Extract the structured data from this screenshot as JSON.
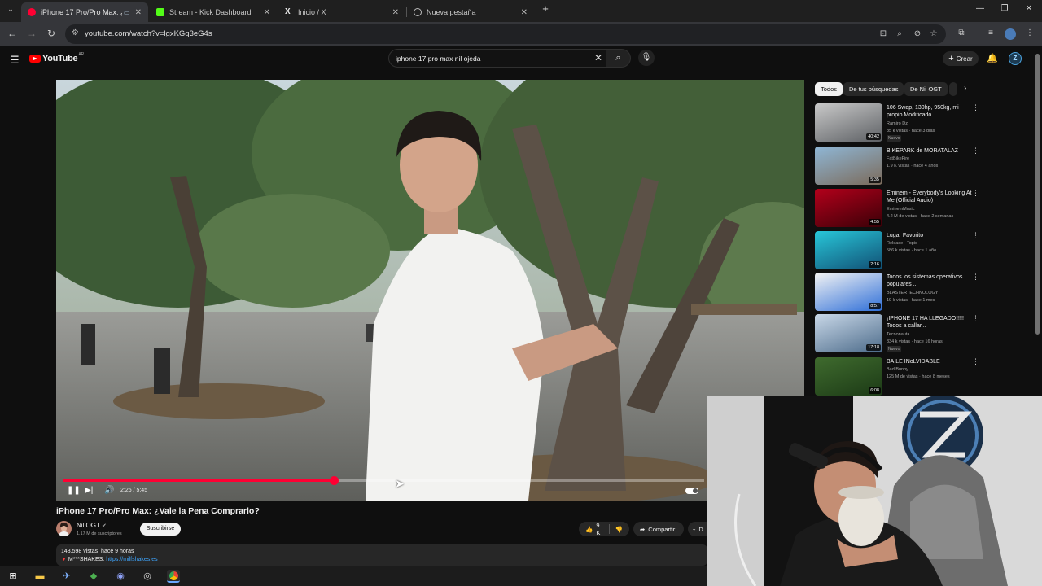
{
  "browser": {
    "tabs": [
      {
        "title": "iPhone 17 Pro/Pro Max: ¿V",
        "active": true,
        "favicon_color": "#ff0033"
      },
      {
        "title": "Stream - Kick Dashboard",
        "active": false,
        "favicon_color": "#53fc18"
      },
      {
        "title": "Inicio / X",
        "active": false,
        "favicon_color": "#e7e7e7"
      },
      {
        "title": "Nueva pestaña",
        "active": false,
        "favicon_color": "#bbbbbb"
      }
    ],
    "url": "youtube.com/watch?v=lgxKGq3eG4s"
  },
  "youtube": {
    "logo_text": "YouTube",
    "country_code": "AR",
    "search_query": "iphone 17 pro max nil ojeda",
    "create_label": "Crear",
    "avatar_letter": "Z"
  },
  "video": {
    "current_time": "2:26",
    "duration": "5:45",
    "progress_fraction": 0.4232,
    "title": "iPhone 17 Pro/Pro Max: ¿Vale la Pena Comprarlo?",
    "channel_name": "Nil OGT",
    "subscribers": "1.17 M de suscriptores",
    "subscribe_label": "Suscribirse",
    "likes": "9 K",
    "share_label": "Compartir",
    "download_label": "D",
    "views": "143,598 vistas",
    "published": "hace 9 horas",
    "desc_prefix": "M***SHAKES:",
    "desc_link": "https://milfshakes.es"
  },
  "sidebar": {
    "chips": [
      "Todos",
      "De tus búsquedas",
      "De Nil OGT"
    ],
    "recommendations": [
      {
        "title": "106 Swap, 130hp, 950kg, mi propio Modificado",
        "channel": "Ramiro Dz",
        "meta": "85 k vistas · hace 3 días",
        "badge": "Nuevo",
        "duration": "40:42",
        "thumb_colors": [
          "#c9c9c9",
          "#5d6064"
        ]
      },
      {
        "title": "BIKEPARK de MORATALAZ",
        "channel": "FatBikeFire",
        "meta": "1.9 K vistas · hace 4 años",
        "badge": "",
        "duration": "5:35",
        "thumb_colors": [
          "#8fb7d6",
          "#7b6a5a"
        ]
      },
      {
        "title": "Eminem - Everybody's Looking At Me (Official Audio)",
        "channel": "EminemMusic",
        "meta": "4.2 M de vistas · hace 2 semanas",
        "badge": "",
        "duration": "4:55",
        "thumb_colors": [
          "#b3001b",
          "#3a0007"
        ]
      },
      {
        "title": "Lugar Favorito",
        "channel": "Release - Topic",
        "meta": "586 k vistas · hace 1 año",
        "badge": "",
        "duration": "2:16",
        "thumb_colors": [
          "#28c7d9",
          "#114f74"
        ]
      },
      {
        "title": "Todos los sistemas operativos populares ...",
        "channel": "BLASTERTECHNOLOGY",
        "meta": "19 k vistas · hace 1 mes",
        "badge": "",
        "duration": "8:57",
        "thumb_colors": [
          "#f4f4f4",
          "#2f6fd8"
        ]
      },
      {
        "title": "¡IPHONE 17 HA LLEGADO!!!!! Todos a callar...",
        "channel": "Tecnonauta",
        "meta": "334 k vistas · hace 16 horas",
        "badge": "Nuevo",
        "duration": "17:18",
        "thumb_colors": [
          "#c9d8e8",
          "#4c6b8a"
        ]
      },
      {
        "title": "BAILE INoLVIDABLE",
        "channel": "Bad Bunny",
        "meta": "125 M de vistas · hace 8 meses",
        "badge": "",
        "duration": "6:08",
        "thumb_colors": [
          "#3f6b2e",
          "#1c3a16"
        ]
      }
    ]
  },
  "taskbar": {
    "icons": [
      "windows-start",
      "file-explorer",
      "steam",
      "python",
      "discord",
      "obs",
      "chrome"
    ]
  }
}
